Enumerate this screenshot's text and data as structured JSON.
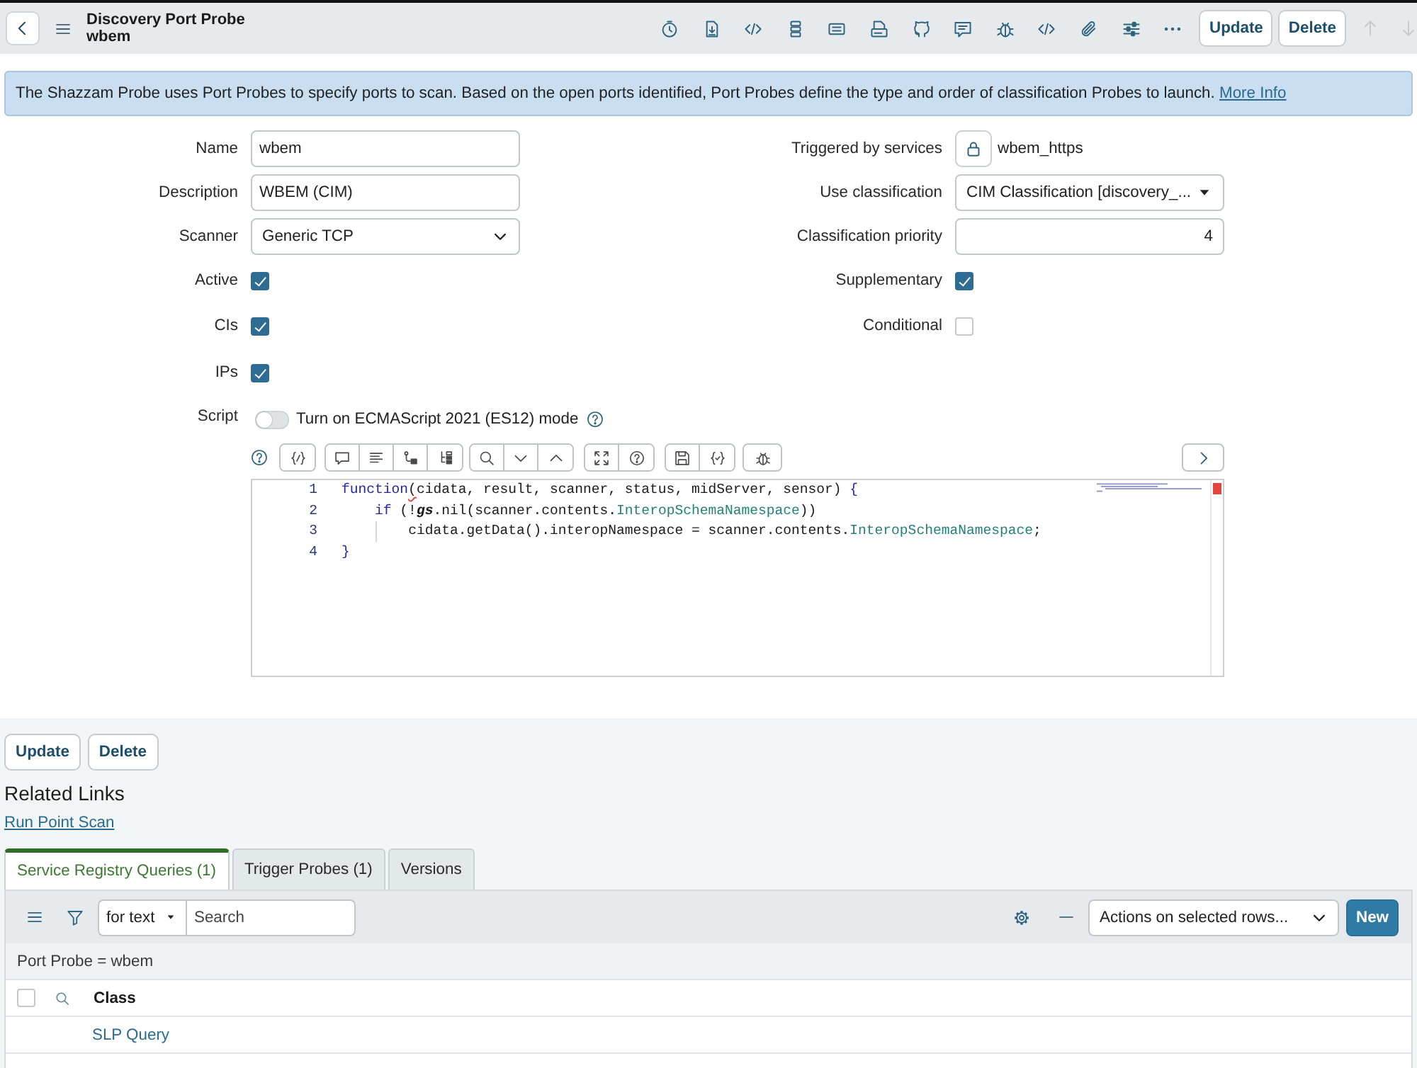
{
  "header": {
    "title": "Discovery Port Probe",
    "subtitle": "wbem",
    "buttons": [
      "Update",
      "Delete"
    ],
    "record_arrows": [
      {
        "disabled": true
      },
      {
        "disabled": true
      }
    ]
  },
  "info_banner": {
    "text": "The Shazzam Probe uses Port Probes to specify ports to scan. Based on the open ports identified, Port Probes define the type and order of classification Probes to launch.",
    "link": "More Info"
  },
  "form": {
    "left_fields": [
      {
        "kind": "text",
        "label": "Name",
        "value": "wbem"
      },
      {
        "kind": "text",
        "label": "Description",
        "value": "WBEM (CIM)"
      },
      {
        "kind": "select",
        "label": "Scanner",
        "value": "Generic TCP"
      },
      {
        "kind": "checkbox",
        "label": "Active",
        "checked": true
      },
      {
        "kind": "checkbox",
        "label": "CIs",
        "checked": true
      },
      {
        "kind": "checkbox",
        "label": "IPs",
        "checked": true
      }
    ],
    "right_fields": [
      {
        "kind": "reference",
        "label": "Triggered by services",
        "value": "wbem_https"
      },
      {
        "kind": "choice",
        "label": "Use classification",
        "value": "CIM Classification [discovery_..."
      },
      {
        "kind": "number",
        "label": "Classification priority",
        "value": "4"
      },
      {
        "kind": "checkbox",
        "label": "Supplementary",
        "checked": true
      },
      {
        "kind": "checkbox",
        "label": "Conditional",
        "checked": false
      }
    ]
  },
  "script": {
    "label": "Script",
    "es_mode_toggle": {
      "label": "Turn on ECMAScript 2021 (ES12) mode",
      "on": false
    },
    "lines": [
      {
        "number": "1",
        "tokens": [
          {
            "kind": "keyword",
            "text": "function"
          },
          {
            "kind": "error",
            "text": "("
          },
          {
            "kind": "plain",
            "text": "cidata, result, scanner, status, midServer, sensor) "
          },
          {
            "kind": "keyword",
            "text": "{"
          }
        ]
      },
      {
        "number": "2",
        "tokens": [
          {
            "kind": "keyword",
            "text": "    if"
          },
          {
            "kind": "plain",
            "text": " (!"
          },
          {
            "kind": "global",
            "text": "gs"
          },
          {
            "kind": "plain",
            "text": ".nil(scanner.contents."
          },
          {
            "kind": "property",
            "text": "InteropSchemaNamespace"
          },
          {
            "kind": "plain",
            "text": "))"
          }
        ]
      },
      {
        "number": "3",
        "tokens": [
          {
            "kind": "plain",
            "text": "        cidata.getData().interopNamespace = scanner.contents."
          },
          {
            "kind": "property",
            "text": "InteropSchemaNamespace"
          },
          {
            "kind": "plain",
            "text": ";"
          }
        ]
      },
      {
        "number": "4",
        "tokens": [
          {
            "kind": "keyword",
            "text": "}"
          }
        ]
      }
    ]
  },
  "form_buttons": [
    "Update",
    "Delete"
  ],
  "related_links": {
    "title": "Related Links",
    "links": [
      "Run Point Scan"
    ]
  },
  "related_lists": {
    "tabs": [
      {
        "label": "Service Registry Queries (1)",
        "selected": true
      },
      {
        "label": "Trigger Probes (1)",
        "selected": false
      },
      {
        "label": "Versions",
        "selected": false
      }
    ],
    "list": {
      "filter_field": "for text",
      "search": {
        "placeholder": "Search"
      },
      "actions": "Actions on selected rows...",
      "new_button": "New",
      "breadcrumb": "Port Probe = wbem",
      "select_all": {
        "checked": false
      },
      "columns": [
        "Class"
      ],
      "rows": [
        [
          "SLP Query"
        ]
      ]
    }
  }
}
